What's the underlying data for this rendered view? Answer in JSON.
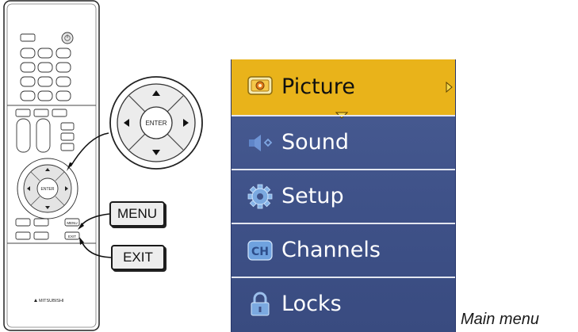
{
  "remote": {
    "pad_center_label": "ENTER",
    "small_buttons": {
      "menu": "MENU",
      "exit": "EXIT"
    },
    "brand": "MITSUBISHI"
  },
  "zoom_pad": {
    "center_label": "ENTER"
  },
  "callouts": {
    "menu": "MENU",
    "exit": "EXIT"
  },
  "main_menu": {
    "items": [
      {
        "label": "Picture",
        "icon": "picture-icon",
        "selected": true
      },
      {
        "label": "Sound",
        "icon": "speaker-icon",
        "selected": false
      },
      {
        "label": "Setup",
        "icon": "gear-icon",
        "selected": false
      },
      {
        "label": "Channels",
        "icon": "channel-icon",
        "selected": false
      },
      {
        "label": "Locks",
        "icon": "lock-icon",
        "selected": false
      }
    ],
    "highlight_color": "#e9b31a",
    "background_color": "#3f5289"
  },
  "caption": "Main menu"
}
